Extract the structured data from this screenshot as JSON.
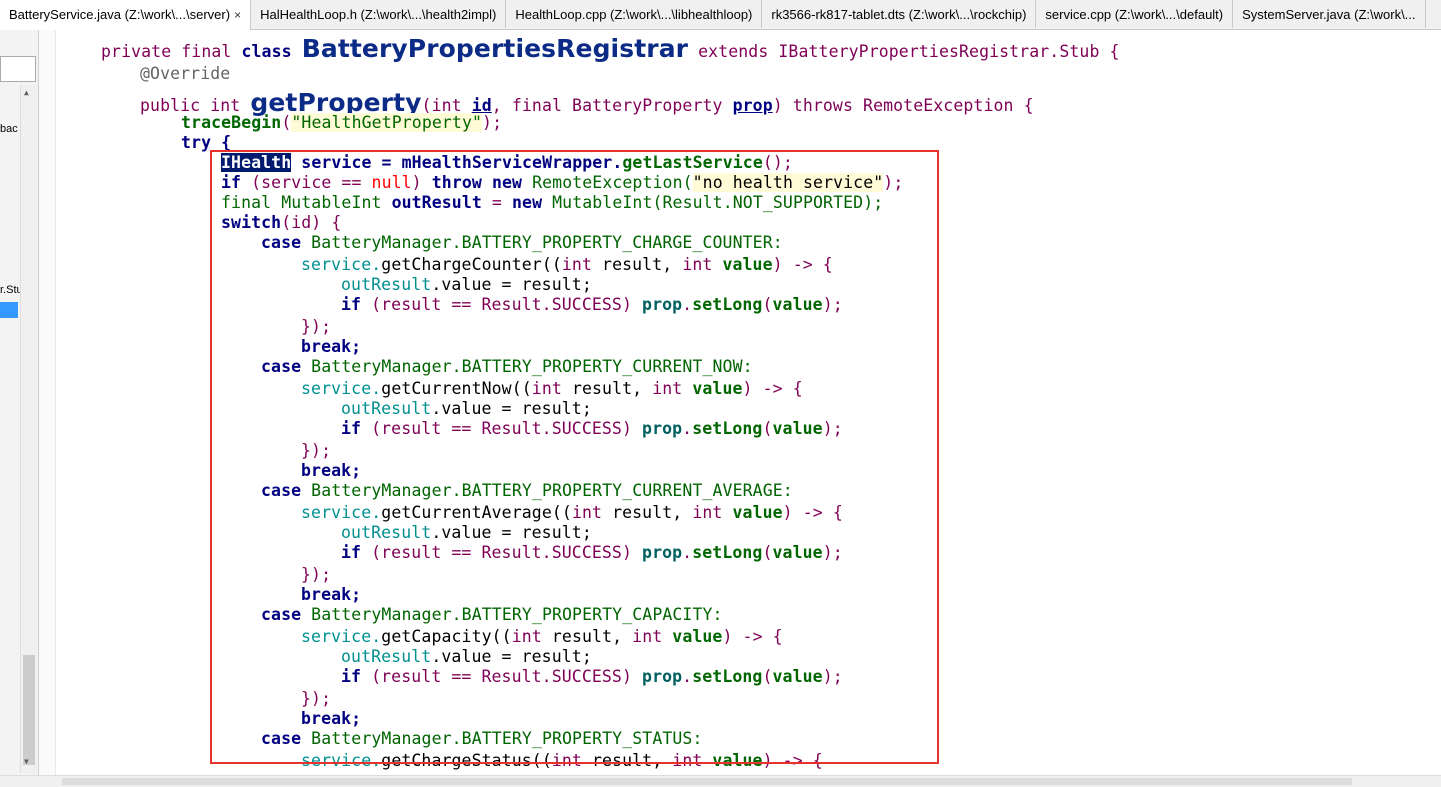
{
  "tabs": [
    {
      "label": "BatteryService.java (Z:\\work\\...\\server)",
      "active": true,
      "close": "×"
    },
    {
      "label": "HalHealthLoop.h (Z:\\work\\...\\health2impl)",
      "active": false
    },
    {
      "label": "HealthLoop.cpp (Z:\\work\\...\\libhealthloop)",
      "active": false
    },
    {
      "label": "rk3566-rk817-tablet.dts (Z:\\work\\...\\rockchip)",
      "active": false
    },
    {
      "label": "service.cpp (Z:\\work\\...\\default)",
      "active": false
    },
    {
      "label": "SystemServer.java (Z:\\work\\...",
      "active": false
    }
  ],
  "left_pane": {
    "frag1": "bac",
    "frag2": "r.Stu"
  },
  "code": {
    "l1": [
      "private final ",
      "class ",
      "BatteryPropertiesRegistrar",
      " extends IBatteryPropertiesRegistrar.Stub {"
    ],
    "l2": [
      "@Override"
    ],
    "l3": [
      "public int ",
      "getProperty",
      "(int ",
      "id",
      ", final BatteryProperty ",
      "prop",
      ") throws RemoteException {"
    ],
    "l4": [
      "traceBegin",
      "(",
      "\"HealthGetProperty\"",
      ");"
    ],
    "l5": [
      "try {"
    ],
    "l6": [
      "IHealth",
      " service = mHealthServiceWrapper.",
      "getLastService",
      "();"
    ],
    "l7": [
      "if",
      " (service == ",
      "null",
      ") ",
      "throw new ",
      "RemoteException(",
      "\"no health service\"",
      ");"
    ],
    "l8": [
      "final MutableInt ",
      "outResult",
      " = ",
      "new ",
      "MutableInt(Result.NOT_SUPPORTED);"
    ],
    "l9": [
      "switch",
      "(id) {"
    ],
    "case1": [
      "case ",
      "BatteryManager.BATTERY_PROPERTY_CHARGE_COUNTER:"
    ],
    "call1": [
      "service.",
      "getChargeCounter((",
      "int ",
      "result, ",
      "int ",
      "value",
      ") -> {"
    ],
    "case2": [
      "case ",
      "BatteryManager.BATTERY_PROPERTY_CURRENT_NOW:"
    ],
    "call2": [
      "service.",
      "getCurrentNow((",
      "int ",
      "result, ",
      "int ",
      "value",
      ") -> {"
    ],
    "case3": [
      "case ",
      "BatteryManager.BATTERY_PROPERTY_CURRENT_AVERAGE:"
    ],
    "call3": [
      "service.",
      "getCurrentAverage((",
      "int ",
      "result, ",
      "int ",
      "value",
      ") -> {"
    ],
    "case4": [
      "case ",
      "BatteryManager.BATTERY_PROPERTY_CAPACITY:"
    ],
    "call4": [
      "service.",
      "getCapacity((",
      "int ",
      "result, ",
      "int ",
      "value",
      ") -> {"
    ],
    "case5": [
      "case ",
      "BatteryManager.BATTERY_PROPERTY_STATUS:"
    ],
    "call5": [
      "service.",
      "getChargeStatus((",
      "int ",
      "result, ",
      "int ",
      "value",
      ") -> {"
    ],
    "assign": [
      "outResult",
      ".value = result;"
    ],
    "ifline": [
      "if",
      " (result == Result.SUCCESS) ",
      "prop",
      ".",
      "setLong",
      "(",
      "value",
      ");"
    ],
    "close": [
      "});"
    ],
    "brk": [
      "break;"
    ]
  },
  "colors": {
    "highlight_box": "#e8322d",
    "selection": "#001a6e"
  }
}
